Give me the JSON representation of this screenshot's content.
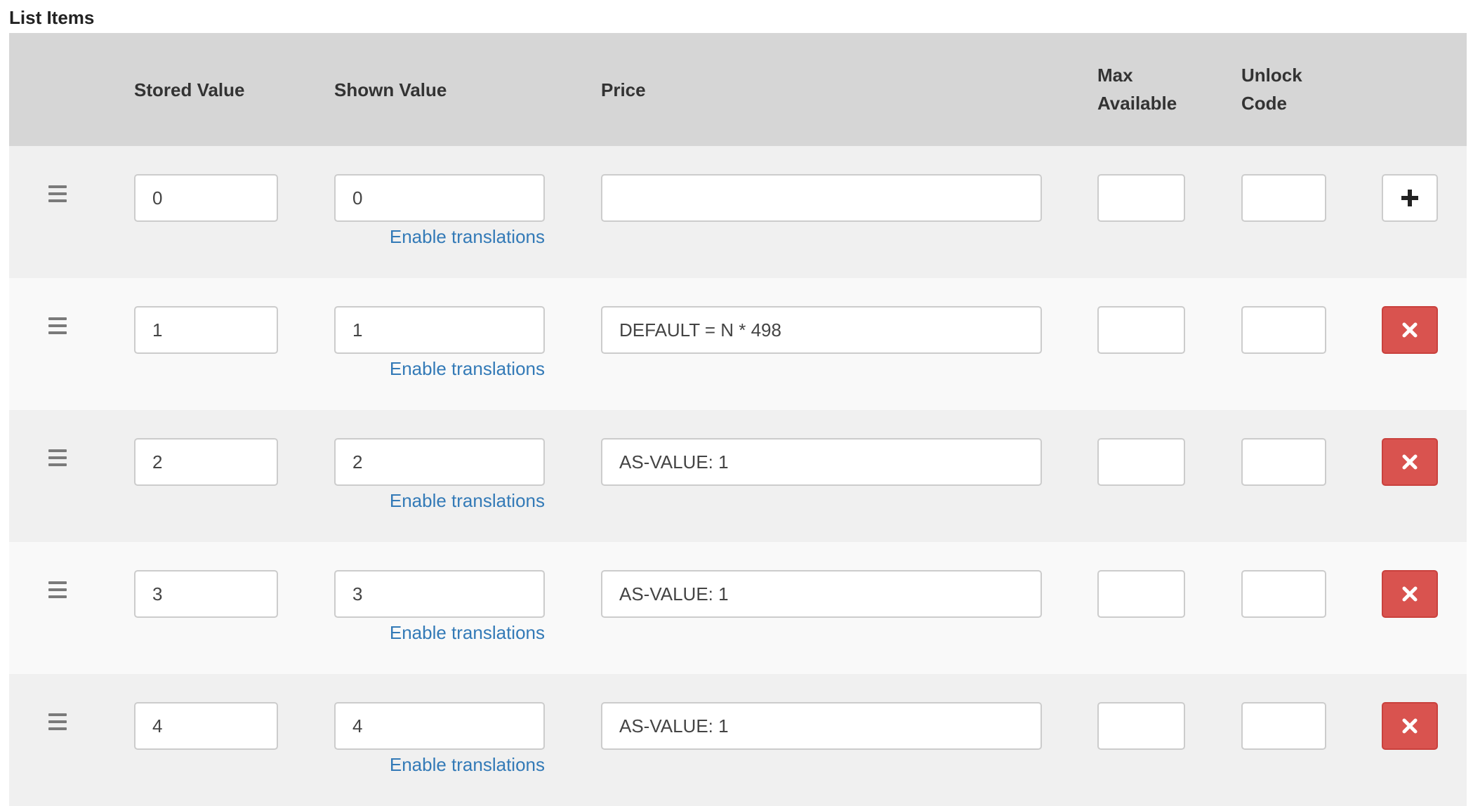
{
  "section_title": "List Items",
  "columns": {
    "stored": "Stored Value",
    "shown": "Shown Value",
    "price": "Price",
    "max_line1": "Max",
    "max_line2": "Available",
    "unlock_line1": "Unlock",
    "unlock_line2": "Code"
  },
  "enable_translations_label": "Enable translations",
  "rows": [
    {
      "stored": "0",
      "shown": "0",
      "price": "",
      "max": "",
      "unlock": "",
      "action": "add"
    },
    {
      "stored": "1",
      "shown": "1",
      "price": "DEFAULT = N * 498",
      "max": "",
      "unlock": "",
      "action": "remove"
    },
    {
      "stored": "2",
      "shown": "2",
      "price": "AS-VALUE: 1",
      "max": "",
      "unlock": "",
      "action": "remove"
    },
    {
      "stored": "3",
      "shown": "3",
      "price": "AS-VALUE: 1",
      "max": "",
      "unlock": "",
      "action": "remove"
    },
    {
      "stored": "4",
      "shown": "4",
      "price": "AS-VALUE: 1",
      "max": "",
      "unlock": "",
      "action": "remove"
    }
  ],
  "icons": {
    "drag": "drag-handle-icon",
    "add": "plus-icon",
    "remove": "times-icon"
  },
  "colors": {
    "header_bg": "#d6d6d6",
    "row_odd": "#f0f0f0",
    "row_even": "#f9f9f9",
    "link": "#337ab7",
    "danger": "#d9534f"
  }
}
